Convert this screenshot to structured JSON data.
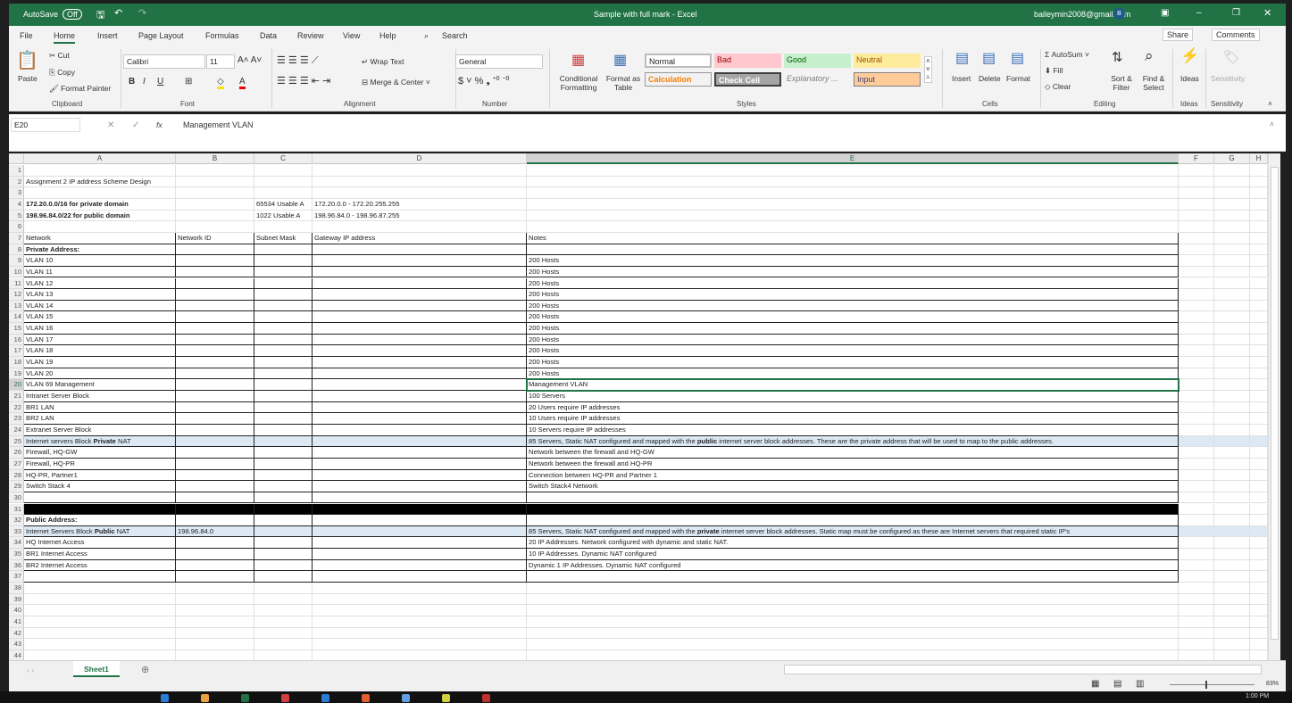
{
  "titlebar": {
    "autosave": "AutoSave",
    "autosave_state": "Off",
    "title": "Sample with full mark  -  Excel",
    "account": "baileymin2008@gmail.com",
    "avatar": "B"
  },
  "ribbon_tabs": [
    "File",
    "Home",
    "Insert",
    "Page Layout",
    "Formulas",
    "Data",
    "Review",
    "View",
    "Help"
  ],
  "search_label": "Search",
  "share": "Share",
  "comments": "Comments",
  "ribbon": {
    "clipboard": {
      "paste": "Paste",
      "cut": "Cut",
      "copy": "Copy",
      "format_painter": "Format Painter",
      "label": "Clipboard"
    },
    "font": {
      "name": "Calibri",
      "size": "11",
      "label": "Font"
    },
    "alignment": {
      "wrap": "Wrap Text",
      "merge": "Merge & Center",
      "label": "Alignment"
    },
    "number": {
      "format": "General",
      "label": "Number"
    },
    "styles": {
      "conditional": "Conditional Formatting",
      "format_table": "Format as Table",
      "normal": "Normal",
      "bad": "Bad",
      "good": "Good",
      "neutral": "Neutral",
      "calculation": "Calculation",
      "check_cell": "Check Cell",
      "explanatory": "Explanatory ...",
      "input": "Input",
      "label": "Styles"
    },
    "cells": {
      "insert": "Insert",
      "delete": "Delete",
      "format": "Format",
      "label": "Cells"
    },
    "editing": {
      "autosum": "AutoSum",
      "fill": "Fill",
      "clear": "Clear",
      "sort": "Sort & Filter",
      "find": "Find & Select",
      "label": "Editing"
    },
    "ideas": {
      "ideas": "Ideas",
      "label": "Ideas"
    },
    "sensitivity": {
      "sensitivity": "Sensitivity",
      "label": "Sensitivity"
    }
  },
  "formula_bar": {
    "name_box": "E20",
    "fx": "fx",
    "value": "Management VLAN"
  },
  "columns": [
    "A",
    "B",
    "C",
    "D",
    "E",
    "F",
    "G",
    "H"
  ],
  "selected_cell": "E20",
  "rows": [
    {
      "n": 1,
      "cells": []
    },
    {
      "n": 2,
      "cells": [
        "Assignment 2 IP address Scheme Design"
      ]
    },
    {
      "n": 3,
      "cells": []
    },
    {
      "n": 4,
      "cells": [
        {
          "t": "172.20.0.0/16 for private domain",
          "b": true
        },
        "",
        "65534 Usable A",
        "172.20.0.0 - 172.20.255.255"
      ]
    },
    {
      "n": 5,
      "cells": [
        {
          "t": "198.96.84.0/22 for public domain",
          "b": true
        },
        "",
        "1022 Usable A",
        "198.96.84.0 - 198.96.87.255"
      ]
    },
    {
      "n": 6,
      "cells": []
    },
    {
      "n": 7,
      "cells": [
        "Network",
        "Network ID",
        "Subnet Mask",
        "Gateway IP address",
        "Notes"
      ]
    },
    {
      "n": 8,
      "cells": [
        {
          "t": "Private Address:",
          "b": true
        }
      ]
    },
    {
      "n": 9,
      "cells": [
        "VLAN 10",
        "",
        "",
        "",
        "200 Hosts"
      ]
    },
    {
      "n": 10,
      "cells": [
        "VLAN 11",
        "",
        "",
        "",
        "200 Hosts"
      ]
    },
    {
      "n": 11,
      "cells": [
        "VLAN 12",
        "",
        "",
        "",
        "200 Hosts"
      ]
    },
    {
      "n": 12,
      "cells": [
        "VLAN 13",
        "",
        "",
        "",
        "200 Hosts"
      ]
    },
    {
      "n": 13,
      "cells": [
        "VLAN 14",
        "",
        "",
        "",
        "200 Hosts"
      ]
    },
    {
      "n": 14,
      "cells": [
        "VLAN 15",
        "",
        "",
        "",
        "200 Hosts"
      ]
    },
    {
      "n": 15,
      "cells": [
        "VLAN 16",
        "",
        "",
        "",
        "200 Hosts"
      ]
    },
    {
      "n": 16,
      "cells": [
        "VLAN 17",
        "",
        "",
        "",
        "200 Hosts"
      ]
    },
    {
      "n": 17,
      "cells": [
        "VLAN 18",
        "",
        "",
        "",
        "200 Hosts"
      ]
    },
    {
      "n": 18,
      "cells": [
        "VLAN 19",
        "",
        "",
        "",
        "200 Hosts"
      ]
    },
    {
      "n": 19,
      "cells": [
        "VLAN 20",
        "",
        "",
        "",
        "200 Hosts"
      ]
    },
    {
      "n": 20,
      "cells": [
        "VLAN 69 Management",
        "",
        "",
        "",
        "Management VLAN"
      ]
    },
    {
      "n": 21,
      "cells": [
        "Intranet Server Block",
        "",
        "",
        "",
        "100 Servers"
      ]
    },
    {
      "n": 22,
      "cells": [
        "BR1  LAN",
        "",
        "",
        "",
        "20 Users require IP addresses"
      ]
    },
    {
      "n": 23,
      "cells": [
        "BR2 LAN",
        "",
        "",
        "",
        "10 Users require IP addresses"
      ]
    },
    {
      "n": 24,
      "cells": [
        "Extranet Server Block",
        "",
        "",
        "",
        "10 Servers require IP addresses"
      ]
    },
    {
      "n": 25,
      "highlight": true,
      "cells": [
        {
          "parts": [
            {
              "t": "Internet servers Block "
            },
            {
              "t": "Private",
              "b": true
            },
            {
              "t": " NAT"
            }
          ]
        },
        "",
        "",
        "",
        {
          "parts": [
            {
              "t": "85 Servers, Static NAT configured and mapped with the "
            },
            {
              "t": "public",
              "b": true
            },
            {
              "t": " internet server block addresses. These are the private address that will be used to map to the public addresses."
            }
          ]
        }
      ]
    },
    {
      "n": 26,
      "cells": [
        "Firewall, HQ-GW",
        "",
        "",
        "",
        "Network between the firewall and HQ-GW"
      ]
    },
    {
      "n": 27,
      "cells": [
        "Firewall, HQ-PR",
        "",
        "",
        "",
        "Network between the firewall and HQ-PR"
      ]
    },
    {
      "n": 28,
      "cells": [
        "HQ-PR, Partner1",
        "",
        "",
        "",
        "Connection between HQ-PR and Partner 1"
      ]
    },
    {
      "n": 29,
      "cells": [
        "Switch Stack 4",
        "",
        "",
        "",
        "Switch Stack4 Network"
      ]
    },
    {
      "n": 30,
      "cells": []
    },
    {
      "n": 31,
      "black": true,
      "cells": []
    },
    {
      "n": 32,
      "cells": [
        {
          "t": "Public Address:",
          "b": true
        }
      ]
    },
    {
      "n": 33,
      "highlight": true,
      "cells": [
        {
          "parts": [
            {
              "t": "Internet Servers Block "
            },
            {
              "t": "Public",
              "b": true
            },
            {
              "t": " NAT"
            }
          ]
        },
        "198.96.84.0",
        "",
        "",
        {
          "parts": [
            {
              "t": "85 Servers, Static NAT configured and mapped with the "
            },
            {
              "t": "private",
              "b": true
            },
            {
              "t": " internet server block addresses. Static map must be configured as these are Internet servers that required static IP's"
            }
          ]
        }
      ]
    },
    {
      "n": 34,
      "cells": [
        "HQ Internet Access",
        "",
        "",
        "",
        "20 IP Addresses. Network configured with dynamic and static NAT."
      ]
    },
    {
      "n": 35,
      "cells": [
        "BR1 Internet Access",
        "",
        "",
        "",
        "10 IP Addresses. Dynamic NAT configured"
      ]
    },
    {
      "n": 36,
      "cells": [
        "BR2 Internet Access",
        "",
        "",
        "",
        "Dynamic 1 IP Addresses. Dynamic NAT configured"
      ]
    },
    {
      "n": 37,
      "cells": []
    },
    {
      "n": 38,
      "cells": []
    },
    {
      "n": 39,
      "cells": []
    },
    {
      "n": 40,
      "cells": []
    },
    {
      "n": 41,
      "cells": []
    },
    {
      "n": 42,
      "cells": []
    },
    {
      "n": 43,
      "cells": []
    },
    {
      "n": 44,
      "cells": []
    }
  ],
  "sheet_tabs": [
    "Sheet1"
  ],
  "status": {
    "zoom": "83%"
  },
  "taskbar": {
    "time": "1:00 PM"
  },
  "colors": {
    "accent": "#217346",
    "highlight_row": "#dce9f5"
  }
}
